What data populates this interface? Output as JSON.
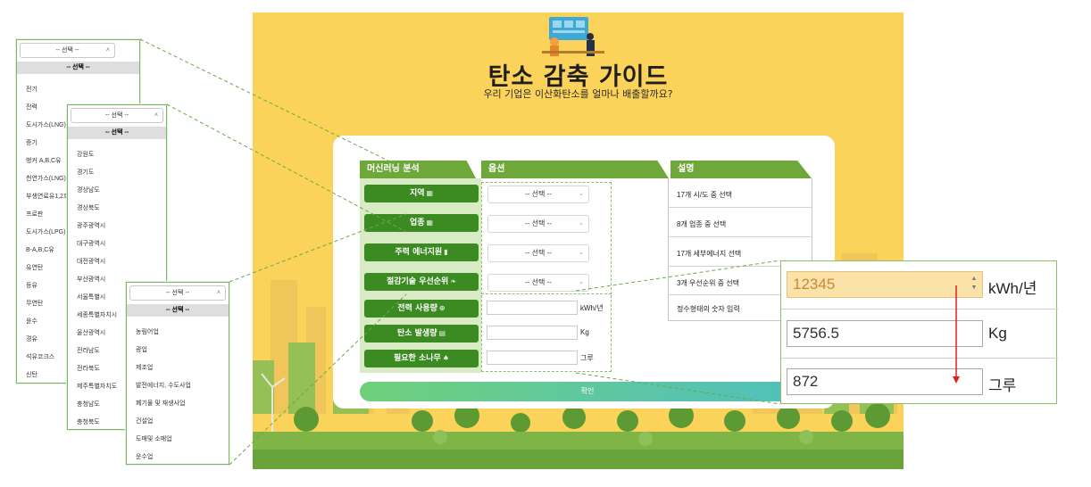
{
  "app": {
    "title": "탄소 감축 가이드",
    "subtitle": "우리 기업은 이산화탄소를 얼마나 배출할까요?"
  },
  "table": {
    "headers": [
      "머신러닝 분석",
      "옵션",
      "설명"
    ],
    "rows": [
      {
        "button": "지역",
        "icon": "building-icon",
        "select": "-- 선택 --",
        "desc": "17개 시/도 중 선택"
      },
      {
        "button": "업종",
        "icon": "building-icon",
        "select": "-- 선택 --",
        "desc": "8개 업종 중 선택"
      },
      {
        "button": "주력 에너지원",
        "icon": "battery-icon",
        "select": "-- 선택 --",
        "desc": "17개 세부에너지 선택"
      },
      {
        "button": "절감기술 우선순위",
        "icon": "leaf-icon",
        "select": "-- 선택 --",
        "desc": "3개 우선순위 중 선택"
      }
    ],
    "inputs": [
      {
        "button": "전력 사용량",
        "icon": "plug-icon",
        "unit": "kWh/년",
        "desc": "정수형태의 숫자 입력"
      },
      {
        "button": "탄소 발생량",
        "icon": "factory-icon",
        "unit": "Kg",
        "desc": ""
      },
      {
        "button": "필요한 소나무",
        "icon": "tree-icon",
        "unit": "그루",
        "desc": ""
      }
    ],
    "confirm": "확인"
  },
  "energy_dropdown": {
    "selected": "-- 선택 --",
    "header": "-- 선택 --",
    "items": [
      "전기",
      "전력",
      "도시가스(LNG)",
      "증기",
      "벙커 A,B,C유",
      "천연가스(LNG)",
      "부생연료유1,2호",
      "프로판",
      "도시가스(LPG)",
      "B-A,B,C유",
      "유연탄",
      "등유",
      "무연탄",
      "윤수",
      "경유",
      "석유코크스",
      "신탄"
    ]
  },
  "region_dropdown": {
    "selected": "-- 선택 --",
    "header": "-- 선택 --",
    "items": [
      "강원도",
      "경기도",
      "경상남도",
      "경상북도",
      "광주광역시",
      "대구광역시",
      "대전광역시",
      "부산광역시",
      "서울특별시",
      "세종특별자치시",
      "울산광역시",
      "전라남도",
      "전라북도",
      "제주특별자치도",
      "충청남도",
      "충청북도"
    ]
  },
  "industry_dropdown": {
    "selected": "-- 선택 --",
    "header": "-- 선택 --",
    "items": [
      "농림어업",
      "광업",
      "제조업",
      "발전에너지, 수도사업",
      "폐기물 및 재생사업",
      "건설업",
      "도매및 소매업",
      "운수업"
    ]
  },
  "zoom": {
    "power_value": "12345",
    "power_unit": "kWh/년",
    "carbon_value": "5756.5",
    "carbon_unit": "Kg",
    "trees_value": "872",
    "trees_unit": "그루"
  },
  "colors": {
    "page_bg": "#fbd35a",
    "primary_green": "#3c8a22",
    "header_green": "#6fa83a",
    "arrow_red": "#e02020"
  }
}
